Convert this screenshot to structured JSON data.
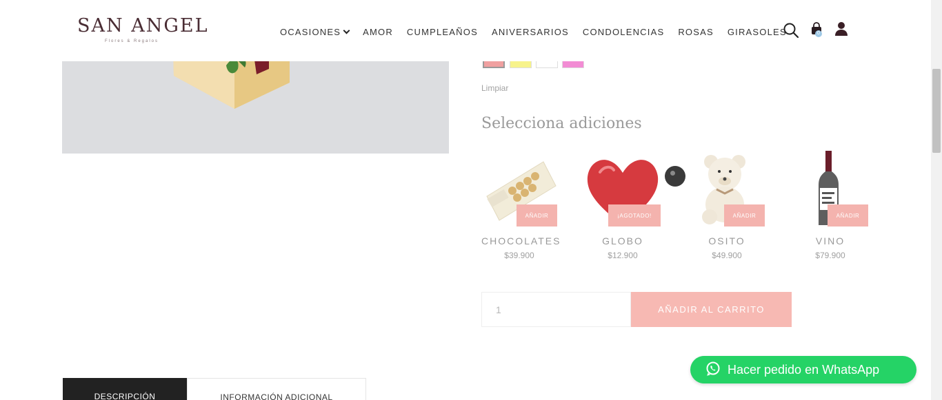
{
  "brand": {
    "name": "SAN ANGEL",
    "tagline": "Flores & Regalos"
  },
  "nav": {
    "items": [
      {
        "label": "OCASIONES",
        "has_dropdown": true
      },
      {
        "label": "AMOR"
      },
      {
        "label": "CUMPLEAÑOS"
      },
      {
        "label": "ANIVERSARIOS"
      },
      {
        "label": "CONDOLENCIAS"
      },
      {
        "label": "ROSAS"
      },
      {
        "label": "GIRASOLES"
      }
    ],
    "icons": [
      "search-icon",
      "cart-icon",
      "user-icon"
    ],
    "cart_count": "0"
  },
  "product": {
    "color_swatches": [
      "#f0a0a0",
      "#f7f38c",
      "#ffffff",
      "#f28cd4"
    ],
    "selected_swatch": 0,
    "clear_label": "Limpiar"
  },
  "addons": {
    "title": "Selecciona adiciones",
    "items": [
      {
        "name": "CHOCOLATES",
        "price": "$39.900",
        "button": "AÑADIR"
      },
      {
        "name": "GLOBO",
        "price": "$12.900",
        "button": "¡AGOTADO!"
      },
      {
        "name": "OSITO",
        "price": "$49.900",
        "button": "AÑADIR"
      },
      {
        "name": "VINO",
        "price": "$79.900",
        "button": "AÑADIR"
      }
    ]
  },
  "cart": {
    "quantity": "1",
    "add_label": "AÑADIR AL CARRITO"
  },
  "whatsapp": {
    "label": "Hacer pedido en WhatsApp"
  },
  "tabs": [
    {
      "label": "DESCRIPCIÓN",
      "active": true
    },
    {
      "label": "INFORMACIÓN ADICIONAL",
      "active": false
    }
  ],
  "colors": {
    "accent": "#f4b3ae",
    "whatsapp": "#25d366",
    "brand": "#4a2d34"
  }
}
